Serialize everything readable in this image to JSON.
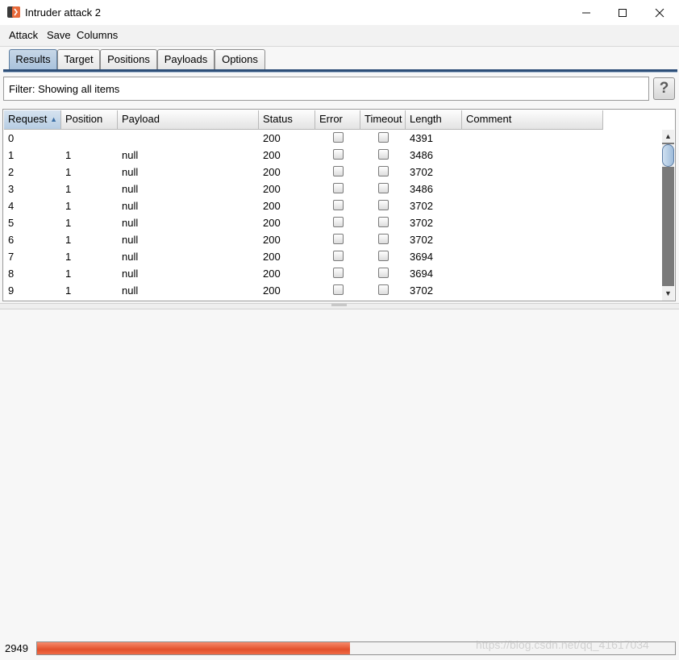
{
  "window": {
    "title": "Intruder attack 2",
    "accent_color": "#e14b1e"
  },
  "menu": {
    "items": [
      "Attack",
      "Save",
      "Columns"
    ]
  },
  "tabs": [
    {
      "label": "Results",
      "active": true
    },
    {
      "label": "Target",
      "active": false
    },
    {
      "label": "Positions",
      "active": false
    },
    {
      "label": "Payloads",
      "active": false
    },
    {
      "label": "Options",
      "active": false
    }
  ],
  "filter": {
    "text": "Filter: Showing all items",
    "help_label": "?"
  },
  "table": {
    "columns": [
      "Request",
      "Position",
      "Payload",
      "Status",
      "Error",
      "Timeout",
      "Length",
      "Comment"
    ],
    "sorted_column": "Request",
    "sort_direction": "ascending",
    "rows": [
      {
        "request": "0",
        "position": "",
        "payload": "",
        "status": "200",
        "error": false,
        "timeout": false,
        "length": "4391",
        "comment": ""
      },
      {
        "request": "1",
        "position": "1",
        "payload": "null",
        "status": "200",
        "error": false,
        "timeout": false,
        "length": "3486",
        "comment": ""
      },
      {
        "request": "2",
        "position": "1",
        "payload": "null",
        "status": "200",
        "error": false,
        "timeout": false,
        "length": "3702",
        "comment": ""
      },
      {
        "request": "3",
        "position": "1",
        "payload": "null",
        "status": "200",
        "error": false,
        "timeout": false,
        "length": "3486",
        "comment": ""
      },
      {
        "request": "4",
        "position": "1",
        "payload": "null",
        "status": "200",
        "error": false,
        "timeout": false,
        "length": "3702",
        "comment": ""
      },
      {
        "request": "5",
        "position": "1",
        "payload": "null",
        "status": "200",
        "error": false,
        "timeout": false,
        "length": "3702",
        "comment": ""
      },
      {
        "request": "6",
        "position": "1",
        "payload": "null",
        "status": "200",
        "error": false,
        "timeout": false,
        "length": "3702",
        "comment": ""
      },
      {
        "request": "7",
        "position": "1",
        "payload": "null",
        "status": "200",
        "error": false,
        "timeout": false,
        "length": "3694",
        "comment": ""
      },
      {
        "request": "8",
        "position": "1",
        "payload": "null",
        "status": "200",
        "error": false,
        "timeout": false,
        "length": "3694",
        "comment": ""
      },
      {
        "request": "9",
        "position": "1",
        "payload": "null",
        "status": "200",
        "error": false,
        "timeout": false,
        "length": "3702",
        "comment": ""
      }
    ]
  },
  "status": {
    "count": "2949",
    "progress_fraction": 0.49
  },
  "watermark": "https://blog.csdn.net/qq_41617034"
}
